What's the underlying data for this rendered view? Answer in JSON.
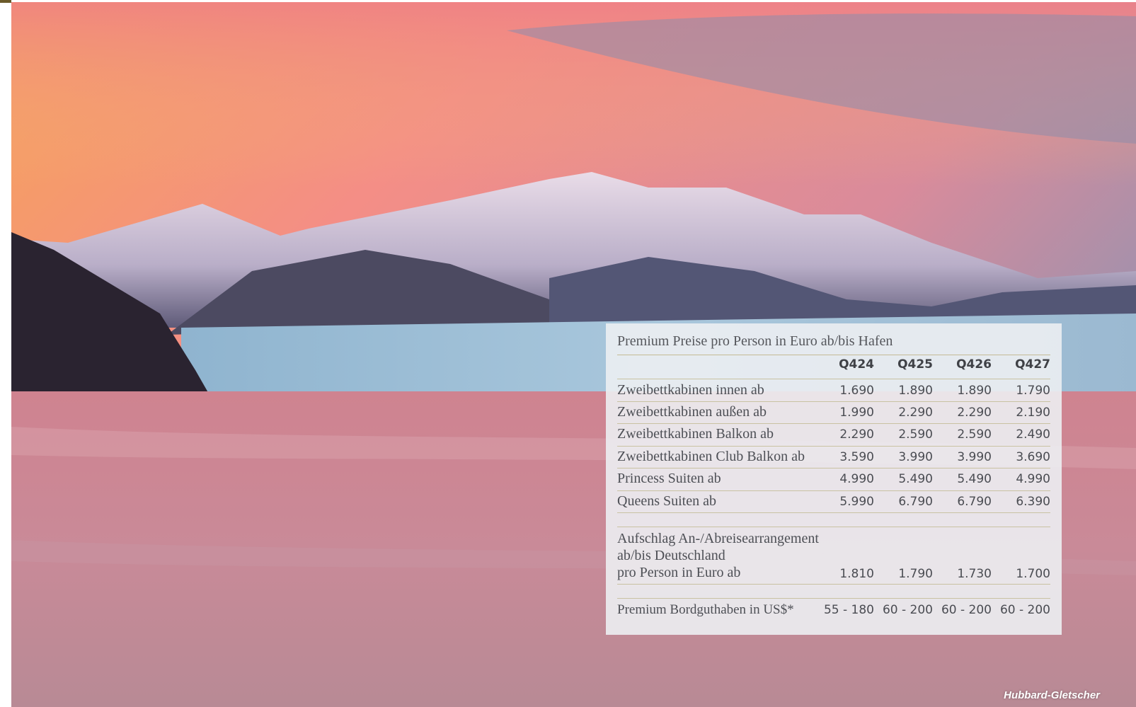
{
  "panel": {
    "title": "Premium Preise pro Person in Euro ab/bis Hafen",
    "columns": [
      "Q424",
      "Q425",
      "Q426",
      "Q427"
    ],
    "rows": [
      {
        "label": "Zweibettkabinen innen ab",
        "values": [
          "1.690",
          "1.890",
          "1.890",
          "1.790"
        ]
      },
      {
        "label": "Zweibettkabinen außen ab",
        "values": [
          "1.990",
          "2.290",
          "2.290",
          "2.190"
        ]
      },
      {
        "label": "Zweibettkabinen Balkon ab",
        "values": [
          "2.290",
          "2.590",
          "2.590",
          "2.490"
        ]
      },
      {
        "label": "Zweibettkabinen Club Balkon ab",
        "values": [
          "3.590",
          "3.990",
          "3.990",
          "3.690"
        ]
      },
      {
        "label": "Princess Suiten ab",
        "values": [
          "4.990",
          "5.490",
          "5.490",
          "4.990"
        ]
      },
      {
        "label": "Queens Suiten ab",
        "values": [
          "5.990",
          "6.790",
          "6.790",
          "6.390"
        ]
      }
    ],
    "surcharge": {
      "lines": [
        "Aufschlag An-/Abreisearrangement",
        "ab/bis Deutschland",
        "pro Person in Euro ab"
      ],
      "values": [
        "1.810",
        "1.790",
        "1.730",
        "1.700"
      ]
    },
    "credit": {
      "label": "Premium Bordguthaben in US$*",
      "values": [
        "55 - 180",
        "60 - 200",
        "60 - 200",
        "60 - 200"
      ]
    }
  },
  "caption": "Hubbard-Gletscher",
  "colors": {
    "panel_bg": "#eceef2",
    "rule": "#c9c2a2",
    "text": "#4d4f55"
  }
}
